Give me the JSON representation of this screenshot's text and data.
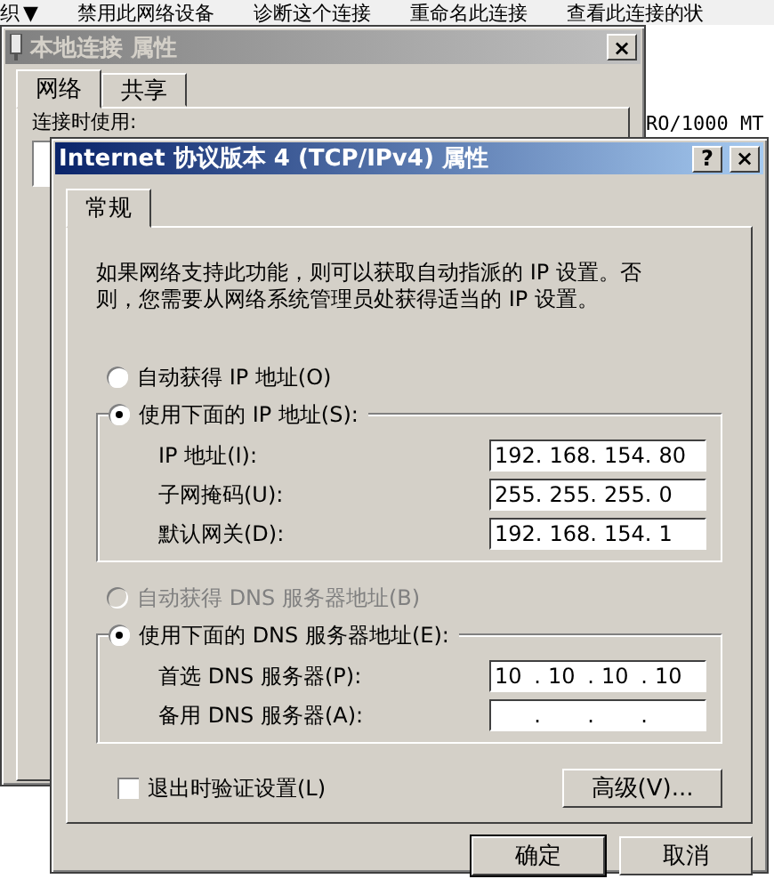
{
  "toolbar": {
    "items": [
      {
        "label": "织",
        "caret": "▼"
      },
      {
        "label": "禁用此网络设备"
      },
      {
        "label": "诊断这个连接"
      },
      {
        "label": "重命名此连接"
      },
      {
        "label": "查看此连接的状"
      }
    ]
  },
  "background_panel": {
    "device_text": "RO/1000 MT"
  },
  "back_window": {
    "title": "本地连接 属性",
    "close": "×",
    "tabs": [
      {
        "label": "网络",
        "selected": true
      },
      {
        "label": "共享",
        "selected": false
      }
    ],
    "connect_using_label": "连接时使用:"
  },
  "dialog": {
    "title": "Internet 协议版本 4 (TCP/IPv4) 属性",
    "help": "?",
    "close": "×",
    "tabs": [
      {
        "label": "常规",
        "selected": true
      }
    ],
    "octet_separator": ".",
    "intro": "如果网络支持此功能，则可以获取自动指派的 IP 设置。否则，您需要从网络系统管理员处获得适当的 IP 设置。",
    "ip_mode": [
      {
        "label": "自动获得 IP 地址(O)",
        "selected": false,
        "disabled": false
      },
      {
        "label": "使用下面的 IP 地址(S):",
        "selected": true,
        "disabled": false
      }
    ],
    "ip_fields": [
      {
        "label": "IP 地址(I):",
        "octets": [
          "192",
          "168",
          "154",
          "80"
        ]
      },
      {
        "label": "子网掩码(U):",
        "octets": [
          "255",
          "255",
          "255",
          "0"
        ]
      },
      {
        "label": "默认网关(D):",
        "octets": [
          "192",
          "168",
          "154",
          "1"
        ]
      }
    ],
    "dns_mode": [
      {
        "label": "自动获得 DNS 服务器地址(B)",
        "selected": false,
        "disabled": true
      },
      {
        "label": "使用下面的 DNS 服务器地址(E):",
        "selected": true,
        "disabled": false
      }
    ],
    "dns_fields": [
      {
        "label": "首选 DNS 服务器(P):",
        "octets": [
          "10",
          "10",
          "10",
          "10"
        ]
      },
      {
        "label": "备用 DNS 服务器(A):"
      }
    ],
    "validate": {
      "label": "退出时验证设置(L)",
      "checked": false
    },
    "advanced_button": "高级(V)...",
    "buttons": [
      {
        "label": "确定",
        "default": true
      },
      {
        "label": "取消",
        "default": false
      }
    ]
  }
}
